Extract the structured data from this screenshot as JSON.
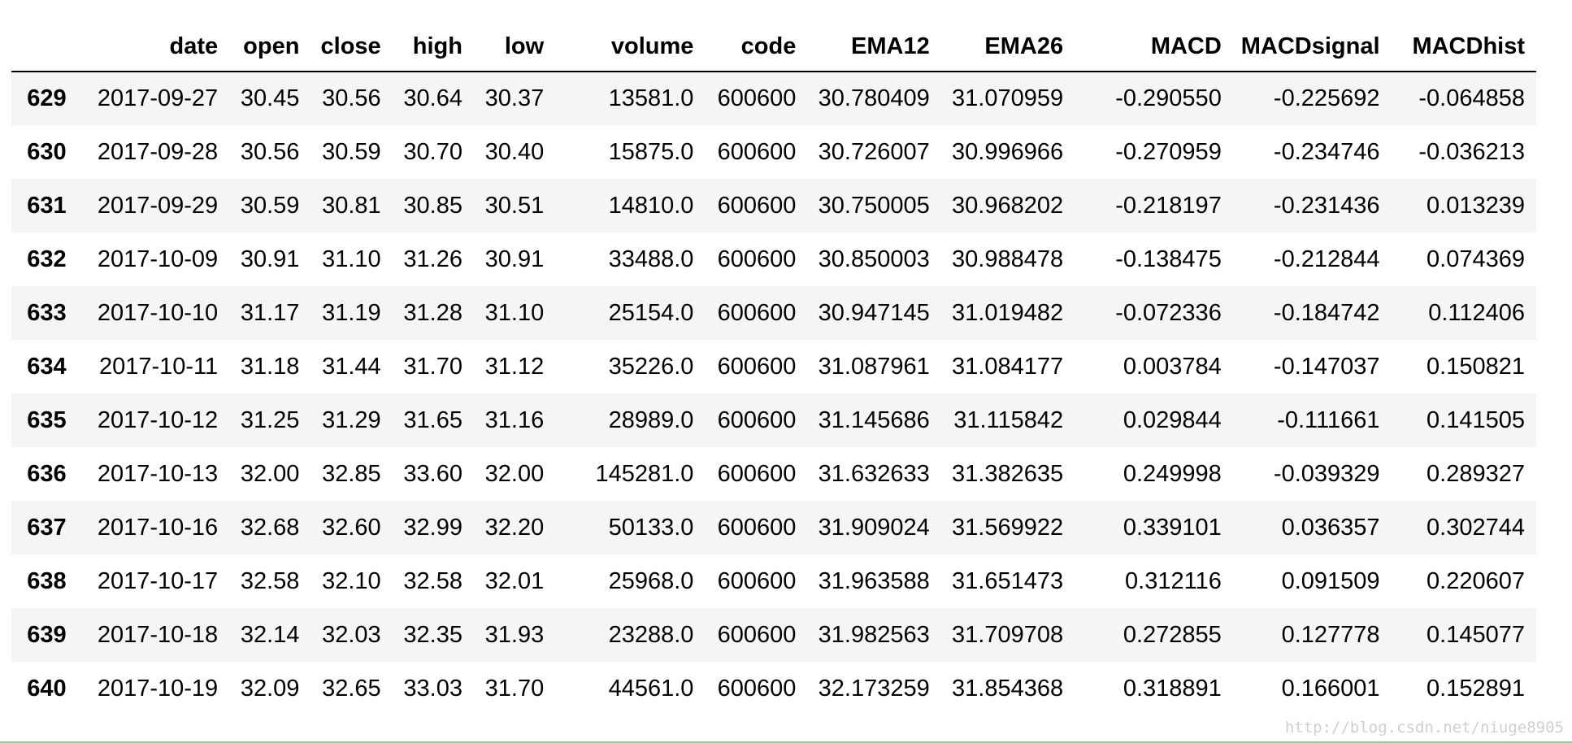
{
  "table": {
    "columns": [
      "",
      "date",
      "open",
      "close",
      "high",
      "low",
      "volume",
      "code",
      "EMA12",
      "EMA26",
      "MACD",
      "MACDsignal",
      "MACDhist"
    ],
    "rows": [
      {
        "index": "629",
        "cells": [
          "2017-09-27",
          "30.45",
          "30.56",
          "30.64",
          "30.37",
          "13581.0",
          "600600",
          "30.780409",
          "31.070959",
          "-0.290550",
          "-0.225692",
          "-0.064858"
        ]
      },
      {
        "index": "630",
        "cells": [
          "2017-09-28",
          "30.56",
          "30.59",
          "30.70",
          "30.40",
          "15875.0",
          "600600",
          "30.726007",
          "30.996966",
          "-0.270959",
          "-0.234746",
          "-0.036213"
        ]
      },
      {
        "index": "631",
        "cells": [
          "2017-09-29",
          "30.59",
          "30.81",
          "30.85",
          "30.51",
          "14810.0",
          "600600",
          "30.750005",
          "30.968202",
          "-0.218197",
          "-0.231436",
          "0.013239"
        ]
      },
      {
        "index": "632",
        "cells": [
          "2017-10-09",
          "30.91",
          "31.10",
          "31.26",
          "30.91",
          "33488.0",
          "600600",
          "30.850003",
          "30.988478",
          "-0.138475",
          "-0.212844",
          "0.074369"
        ]
      },
      {
        "index": "633",
        "cells": [
          "2017-10-10",
          "31.17",
          "31.19",
          "31.28",
          "31.10",
          "25154.0",
          "600600",
          "30.947145",
          "31.019482",
          "-0.072336",
          "-0.184742",
          "0.112406"
        ]
      },
      {
        "index": "634",
        "cells": [
          "2017-10-11",
          "31.18",
          "31.44",
          "31.70",
          "31.12",
          "35226.0",
          "600600",
          "31.087961",
          "31.084177",
          "0.003784",
          "-0.147037",
          "0.150821"
        ]
      },
      {
        "index": "635",
        "cells": [
          "2017-10-12",
          "31.25",
          "31.29",
          "31.65",
          "31.16",
          "28989.0",
          "600600",
          "31.145686",
          "31.115842",
          "0.029844",
          "-0.111661",
          "0.141505"
        ]
      },
      {
        "index": "636",
        "cells": [
          "2017-10-13",
          "32.00",
          "32.85",
          "33.60",
          "32.00",
          "145281.0",
          "600600",
          "31.632633",
          "31.382635",
          "0.249998",
          "-0.039329",
          "0.289327"
        ]
      },
      {
        "index": "637",
        "cells": [
          "2017-10-16",
          "32.68",
          "32.60",
          "32.99",
          "32.20",
          "50133.0",
          "600600",
          "31.909024",
          "31.569922",
          "0.339101",
          "0.036357",
          "0.302744"
        ]
      },
      {
        "index": "638",
        "cells": [
          "2017-10-17",
          "32.58",
          "32.10",
          "32.58",
          "32.01",
          "25968.0",
          "600600",
          "31.963588",
          "31.651473",
          "0.312116",
          "0.091509",
          "0.220607"
        ]
      },
      {
        "index": "639",
        "cells": [
          "2017-10-18",
          "32.14",
          "32.03",
          "32.35",
          "31.93",
          "23288.0",
          "600600",
          "31.982563",
          "31.709708",
          "0.272855",
          "0.127778",
          "0.145077"
        ]
      },
      {
        "index": "640",
        "cells": [
          "2017-10-19",
          "32.09",
          "32.65",
          "33.03",
          "31.70",
          "44561.0",
          "600600",
          "32.173259",
          "31.854368",
          "0.318891",
          "0.166001",
          "0.152891"
        ]
      }
    ]
  },
  "watermark": "http://blog.csdn.net/niuge8905",
  "colors": {
    "row_stripe": "#f5f5f5",
    "header_rule": "#000000",
    "bottom_rule": "#9bc79b",
    "watermark": "#cfcfcf"
  }
}
